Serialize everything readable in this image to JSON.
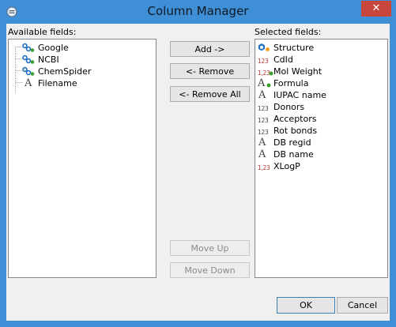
{
  "window": {
    "title": "Column Manager",
    "close_glyph": "✕"
  },
  "available": {
    "label": "Available fields:",
    "items": [
      {
        "label": "Google",
        "icon": "link-icon"
      },
      {
        "label": "NCBI",
        "icon": "link-icon"
      },
      {
        "label": "ChemSpider",
        "icon": "link-icon"
      },
      {
        "label": "Filename",
        "icon": "text-field-icon"
      }
    ]
  },
  "selected": {
    "label": "Selected fields:",
    "items": [
      {
        "label": "Structure",
        "icon": "structure-icon"
      },
      {
        "label": "CdId",
        "icon": "integer-icon"
      },
      {
        "label": "Mol Weight",
        "icon": "decimal-calculated-icon"
      },
      {
        "label": "Formula",
        "icon": "text-calculated-icon"
      },
      {
        "label": "IUPAC name",
        "icon": "text-field-icon"
      },
      {
        "label": "Donors",
        "icon": "integer-icon"
      },
      {
        "label": "Acceptors",
        "icon": "integer-icon"
      },
      {
        "label": "Rot bonds",
        "icon": "integer-icon"
      },
      {
        "label": "DB regid",
        "icon": "text-field-icon"
      },
      {
        "label": "DB name",
        "icon": "text-field-icon"
      },
      {
        "label": "XLogP",
        "icon": "decimal-icon"
      }
    ]
  },
  "buttons": {
    "add": "Add ->",
    "remove": "<- Remove",
    "remove_all": "<- Remove All",
    "move_up": "Move Up",
    "move_down": "Move Down",
    "ok": "OK",
    "cancel": "Cancel"
  },
  "icon_text": {
    "integer": "123",
    "decimal": "1,23",
    "letter": "A"
  },
  "colors": {
    "titlebar": "#3e8fd6",
    "close": "#c7463b",
    "link_blue": "#1f6fc4",
    "link_green": "#3aa02f",
    "number_red": "#b7322c"
  }
}
